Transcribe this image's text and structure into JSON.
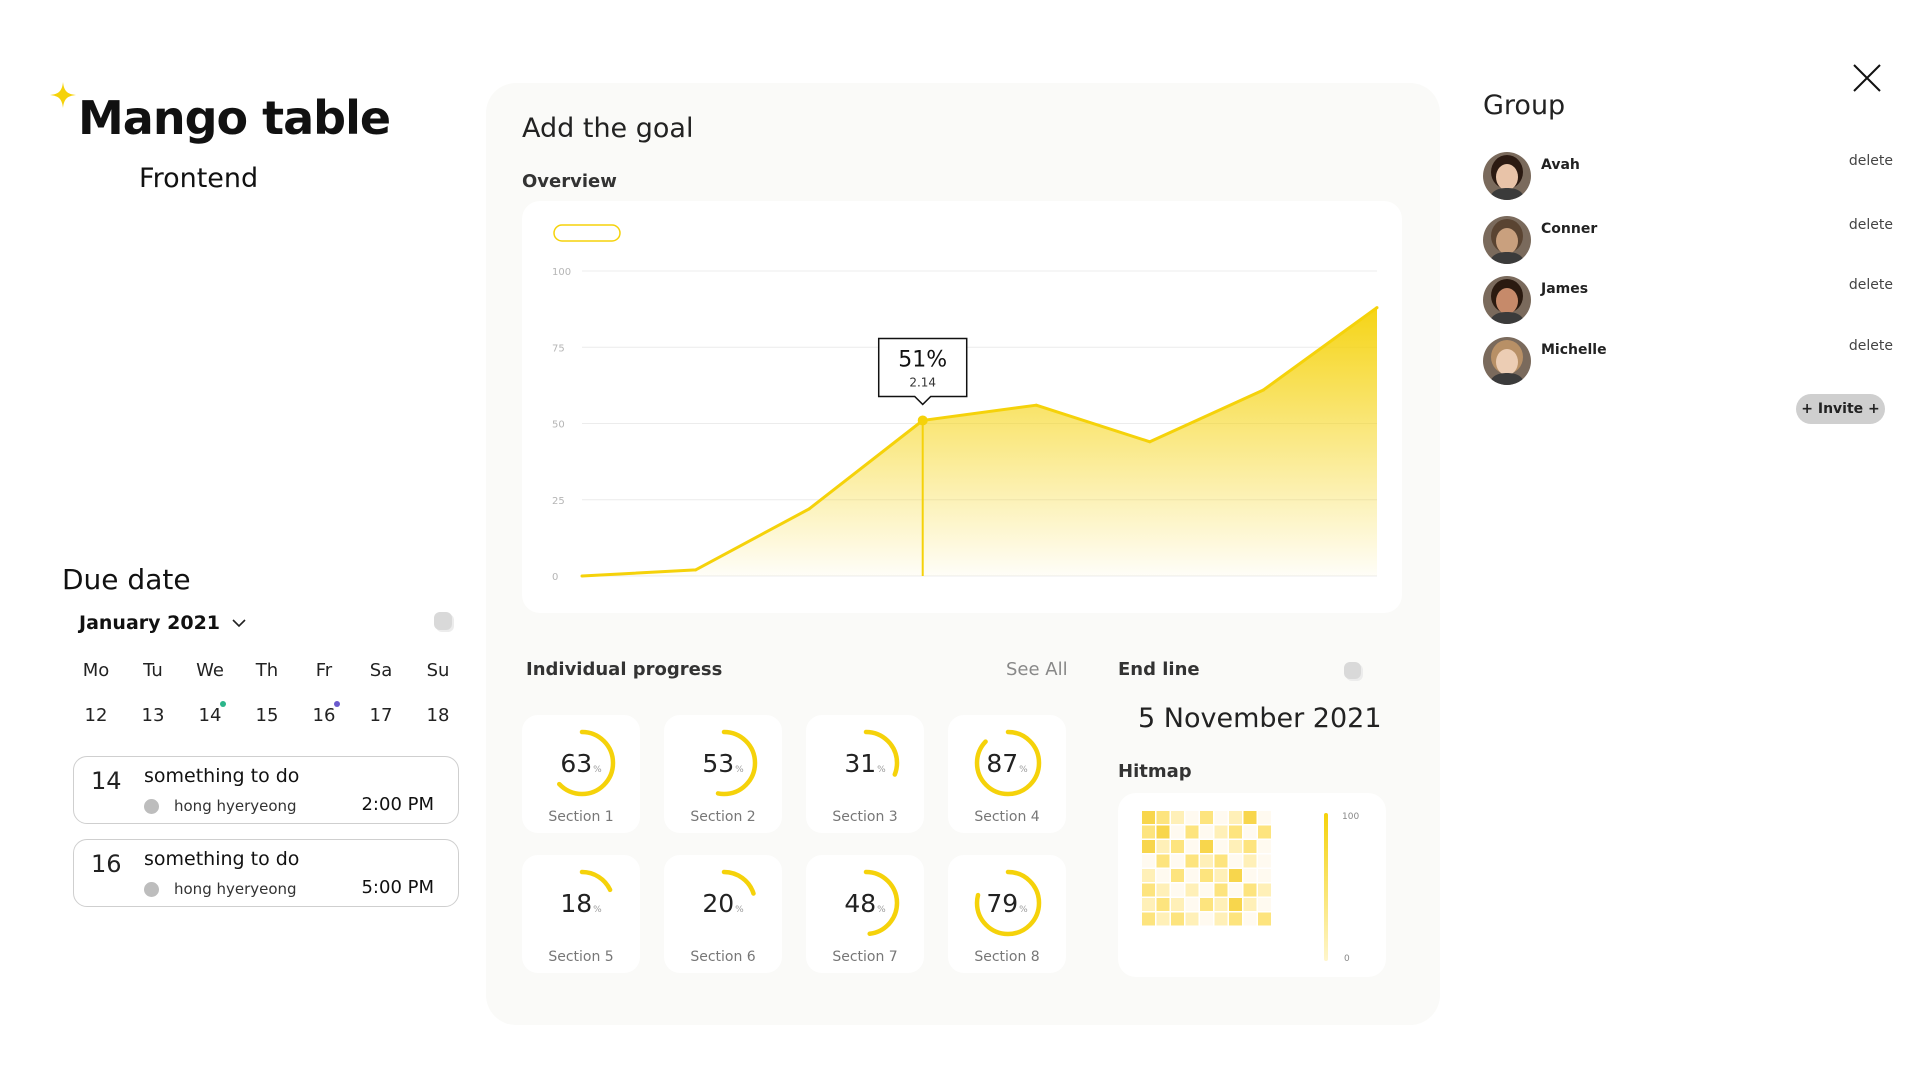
{
  "brand": {
    "title": "Mango table",
    "subtitle": "Frontend",
    "spark_icon": "sparkle-icon",
    "accent": "#f5d20a"
  },
  "due_date": {
    "title": "Due date",
    "month": "January 2021",
    "weekdays": [
      "Mo",
      "Tu",
      "We",
      "Th",
      "Fr",
      "Sa",
      "Su"
    ],
    "dates": [
      "12",
      "13",
      "14",
      "15",
      "16",
      "17",
      "18"
    ],
    "markers": {
      "14": "#2bb58a",
      "16": "#6a5acd"
    },
    "tasks": [
      {
        "day": "14",
        "title": "something to do",
        "person": "hong hyeryeong",
        "time": "2:00 PM"
      },
      {
        "day": "16",
        "title": "something to do",
        "person": "hong hyeryeong",
        "time": "5:00 PM"
      }
    ]
  },
  "goal": {
    "title": "Add the goal",
    "overview_label": "Overview",
    "chart_data": {
      "type": "area",
      "x": [
        0,
        1,
        2,
        3,
        4,
        5,
        6,
        7
      ],
      "values": [
        0,
        2,
        22,
        51,
        56,
        44,
        61,
        88
      ],
      "ylim": [
        0,
        100
      ],
      "yticks": [
        "0",
        "25",
        "50",
        "75",
        "100"
      ],
      "tooltip": {
        "index": 3,
        "value": "51%",
        "sub": "2.14"
      },
      "color": "#f5d20a"
    },
    "progress_label": "Individual  progress",
    "see_all": "See All",
    "sections": [
      {
        "value": "63",
        "pct": 63,
        "label": "Section 1"
      },
      {
        "value": "53",
        "pct": 53,
        "label": "Section 2"
      },
      {
        "value": "31",
        "pct": 31,
        "label": "Section 3"
      },
      {
        "value": "87",
        "pct": 87,
        "label": "Section 4"
      },
      {
        "value": "18",
        "pct": 18,
        "label": "Section 5"
      },
      {
        "value": "20",
        "pct": 20,
        "label": "Section 6"
      },
      {
        "value": "48",
        "pct": 48,
        "label": "Section 7"
      },
      {
        "value": "79",
        "pct": 79,
        "label": "Section 8"
      }
    ],
    "percent_sign": "%",
    "endline_label": "End line",
    "endline_date": "5 November 2021",
    "hitmap_label": "Hitmap",
    "hitmap_scale": {
      "max": "100",
      "min": "0"
    },
    "hitmap_cells": [
      [
        3,
        2,
        1,
        0,
        2,
        0,
        1,
        3,
        0
      ],
      [
        2,
        3,
        0,
        2,
        0,
        1,
        2,
        0,
        2
      ],
      [
        3,
        1,
        2,
        0,
        3,
        0,
        1,
        2,
        0
      ],
      [
        0,
        2,
        0,
        2,
        1,
        2,
        0,
        1,
        0
      ],
      [
        1,
        0,
        2,
        0,
        2,
        1,
        3,
        0,
        0
      ],
      [
        2,
        1,
        0,
        1,
        0,
        2,
        0,
        2,
        1
      ],
      [
        1,
        2,
        1,
        0,
        2,
        1,
        3,
        1,
        0
      ],
      [
        2,
        1,
        2,
        1,
        0,
        1,
        2,
        0,
        2
      ]
    ]
  },
  "group": {
    "title": "Group",
    "members": [
      {
        "name": "Avah",
        "delete": "delete",
        "skin": "#e8c3a8",
        "hair": "#2b1a12"
      },
      {
        "name": "Conner",
        "delete": "delete",
        "skin": "#c9a07e",
        "hair": "#5a4432"
      },
      {
        "name": "James",
        "delete": "delete",
        "skin": "#c68a6a",
        "hair": "#2a1a10"
      },
      {
        "name": "Michelle",
        "delete": "delete",
        "skin": "#eccdb4",
        "hair": "#b89066"
      }
    ],
    "invite": "+ Invite +"
  }
}
